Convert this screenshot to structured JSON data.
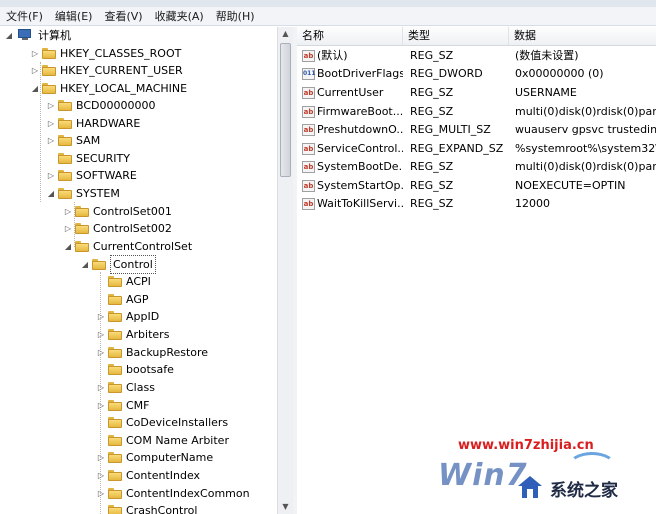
{
  "menu": [
    "文件(F)",
    "编辑(E)",
    "查看(V)",
    "收藏夹(A)",
    "帮助(H)"
  ],
  "tree": {
    "root": "计算机",
    "hkcr": "HKEY_CLASSES_ROOT",
    "hkcu": "HKEY_CURRENT_USER",
    "hklm": "HKEY_LOCAL_MACHINE",
    "hklm_children": [
      "BCD00000000",
      "HARDWARE",
      "SAM",
      "SECURITY",
      "SOFTWARE",
      "SYSTEM"
    ],
    "system_children": [
      "ControlSet001",
      "ControlSet002",
      "CurrentControlSet"
    ],
    "selected": "Control",
    "control_children": [
      "ACPI",
      "AGP",
      "AppID",
      "Arbiters",
      "BackupRestore",
      "bootsafe",
      "Class",
      "CMF",
      "CoDeviceInstallers",
      "COM Name Arbiter",
      "ComputerName",
      "ContentIndex",
      "ContentIndexCommon",
      "CrashControl"
    ]
  },
  "list": {
    "headers": {
      "name": "名称",
      "type": "类型",
      "data": "数据"
    },
    "rows": [
      {
        "name": "(默认)",
        "type": "REG_SZ",
        "data": "(数值未设置)",
        "icon": "ab"
      },
      {
        "name": "BootDriverFlags",
        "type": "REG_DWORD",
        "data": "0x00000000 (0)",
        "icon": "bin"
      },
      {
        "name": "CurrentUser",
        "type": "REG_SZ",
        "data": "USERNAME",
        "icon": "ab"
      },
      {
        "name": "FirmwareBoot...",
        "type": "REG_SZ",
        "data": "multi(0)disk(0)rdisk(0)parti",
        "icon": "ab"
      },
      {
        "name": "PreshutdownO...",
        "type": "REG_MULTI_SZ",
        "data": "wuauserv gpsvc trustedins",
        "icon": "ab"
      },
      {
        "name": "ServiceControl...",
        "type": "REG_EXPAND_SZ",
        "data": "%systemroot%\\system32\\",
        "icon": "ab"
      },
      {
        "name": "SystemBootDe...",
        "type": "REG_SZ",
        "data": "multi(0)disk(0)rdisk(0)parti",
        "icon": "ab"
      },
      {
        "name": "SystemStartOp...",
        "type": "REG_SZ",
        "data": " NOEXECUTE=OPTIN",
        "icon": "ab"
      },
      {
        "name": "WaitToKillServi...",
        "type": "REG_SZ",
        "data": "12000",
        "icon": "ab"
      }
    ]
  },
  "watermark": {
    "url": "www.win7zhijia.cn",
    "logo": "Win7",
    "name": "系统之家"
  },
  "icon_labels": {
    "string": "ab",
    "binary": "011"
  }
}
